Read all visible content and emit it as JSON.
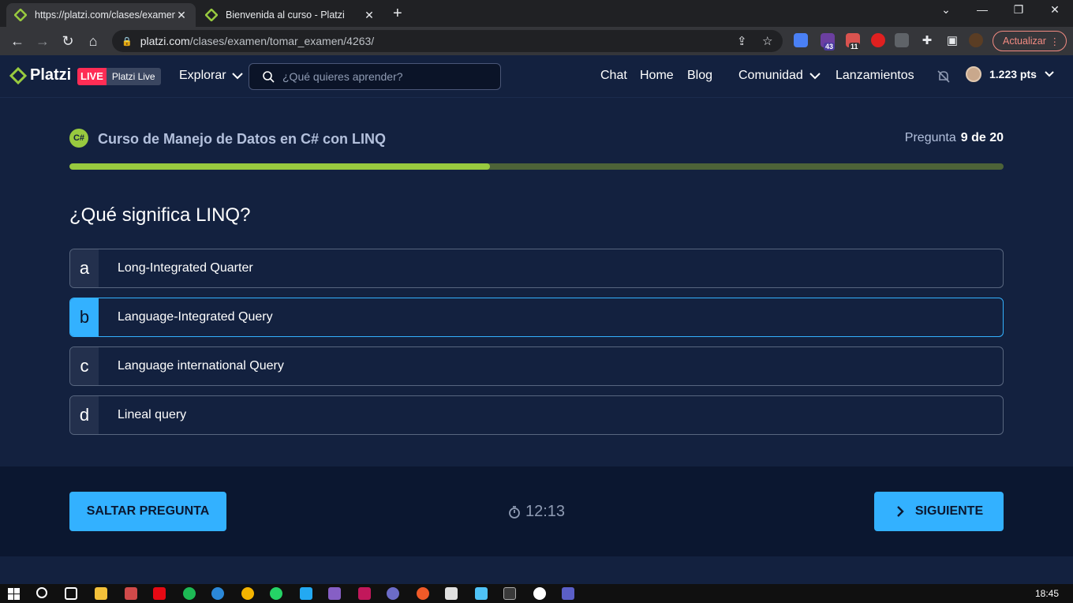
{
  "browser": {
    "tabs": [
      {
        "title": "https://platzi.com/clases/examen/"
      },
      {
        "title": "Bienvenida al curso - Platzi"
      }
    ],
    "url_host": "platzi.com",
    "url_path": "/clases/examen/tomar_examen/4263/",
    "update_label": "Actualizar",
    "ext_badges": {
      "b1": "43",
      "b2": "11"
    }
  },
  "header": {
    "logo": "Platzi",
    "live": "LIVE",
    "live_label": "Platzi Live",
    "explore": "Explorar",
    "search_placeholder": "¿Qué quieres aprender?",
    "nav": {
      "chat": "Chat",
      "home": "Home",
      "blog": "Blog",
      "community": "Comunidad",
      "launches": "Lanzamientos"
    },
    "points": "1.223 pts"
  },
  "exam": {
    "course_icon": "C#",
    "course_title": "Curso de Manejo de Datos en C# con LINQ",
    "question_label": "Pregunta",
    "question_number": "9 de 20",
    "progress_fraction": 0.45,
    "question": "¿Qué significa LINQ?",
    "options": [
      {
        "letter": "a",
        "text": "Long-Integrated Quarter",
        "selected": false
      },
      {
        "letter": "b",
        "text": "Language-Integrated Query",
        "selected": true
      },
      {
        "letter": "c",
        "text": "Language international Query",
        "selected": false
      },
      {
        "letter": "d",
        "text": "Lineal query",
        "selected": false
      }
    ],
    "skip": "SALTAR PREGUNTA",
    "timer": "12:13",
    "next": "SIGUIENTE"
  },
  "taskbar": {
    "clock": "18:45"
  },
  "colors": {
    "accent": "#33b1ff",
    "progress": "#98ca3f",
    "live": "#ff2d55"
  }
}
